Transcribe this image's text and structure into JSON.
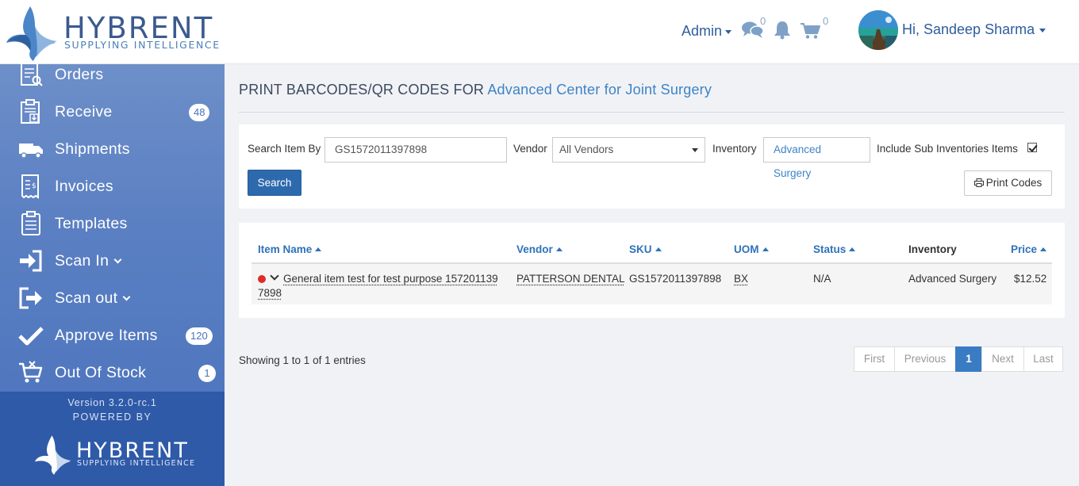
{
  "header": {
    "brand": "HYBRENT",
    "tagline": "SUPPLYING INTELLIGENCE",
    "role_menu": "Admin",
    "messages_count": "0",
    "cart_count": "0",
    "greeting": "Hi, Sandeep Sharma"
  },
  "sidebar": {
    "items": [
      {
        "label": "Orders",
        "icon": "orders-icon"
      },
      {
        "label": "Receive",
        "icon": "clipboard-download-icon",
        "badge": "48"
      },
      {
        "label": "Shipments",
        "icon": "truck-icon"
      },
      {
        "label": "Invoices",
        "icon": "invoice-icon"
      },
      {
        "label": "Templates",
        "icon": "clipboard-list-icon"
      },
      {
        "label": "Scan In",
        "icon": "sign-in-icon"
      },
      {
        "label": "Scan out",
        "icon": "sign-out-icon"
      },
      {
        "label": "Approve Items",
        "icon": "check-icon",
        "badge": "120"
      },
      {
        "label": "Out Of Stock",
        "icon": "cart-remove-icon",
        "badge": "1"
      }
    ],
    "version": "Version 3.2.0-rc.1",
    "powered_by": "POWERED BY",
    "footer_brand": "HYBRENT",
    "footer_tagline": "SUPPLYING INTELLIGENCE"
  },
  "page": {
    "title_prefix": "PRINT BARCODES/QR CODES FOR",
    "location": "Advanced Center for Joint Surgery"
  },
  "search": {
    "search_by_label": "Search Item By",
    "search_value": "GS1572011397898",
    "vendor_label": "Vendor",
    "vendor_selected": "All Vendors",
    "inventory_label": "Inventory",
    "inventory_value": "Advanced Surgery",
    "include_sub_label": "Include Sub Inventories Items",
    "include_sub_checked": true,
    "search_button": "Search",
    "print_button": "Print Codes"
  },
  "table": {
    "columns": [
      "Item Name",
      "Vendor",
      "SKU",
      "UOM",
      "Status",
      "Inventory",
      "Price"
    ],
    "rows": [
      {
        "item_name_line1": "General item test for test purpose 157201139",
        "item_name_line2": "7898",
        "vendor": "PATTERSON DENTAL",
        "sku": "GS1572011397898",
        "uom": "BX",
        "status": "N/A",
        "inventory": "Advanced Surgery",
        "price": "$12.52"
      }
    ]
  },
  "footer": {
    "entries": "Showing 1 to 1 of 1 entries",
    "pager": [
      "First",
      "Previous",
      "1",
      "Next",
      "Last"
    ],
    "current_page": "1"
  },
  "colors": {
    "sidebar": "#5a7fc2",
    "accent": "#2e72b8",
    "button_primary": "#2d6aad",
    "status_dot": "#e02b2b"
  }
}
